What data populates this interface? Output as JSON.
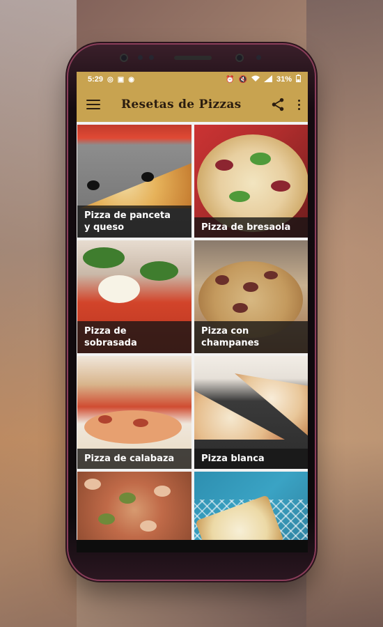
{
  "status_bar": {
    "time": "5:29",
    "left_icons": [
      "whatsapp-icon",
      "image-icon",
      "app-icon"
    ],
    "right_icons": [
      "alarm-icon",
      "mute-icon",
      "wifi-icon",
      "signal-icon"
    ],
    "battery": "31%"
  },
  "app_bar": {
    "title": "Resetas  de Pizzas",
    "menu_icon": "hamburger-menu-icon",
    "share_icon": "share-icon",
    "more_icon": "more-vertical-icon"
  },
  "colors": {
    "app_bar": "#c8a350",
    "caption_bg": "#141414"
  },
  "recipes": [
    {
      "title": "Pizza de panceta\ny queso"
    },
    {
      "title": "Pizza de bresaola"
    },
    {
      "title": "Pizza de\nsobrasada"
    },
    {
      "title": "Pizza con\nchampanes"
    },
    {
      "title": "Pizza de calabaza"
    },
    {
      "title": "Pizza blanca"
    }
  ]
}
